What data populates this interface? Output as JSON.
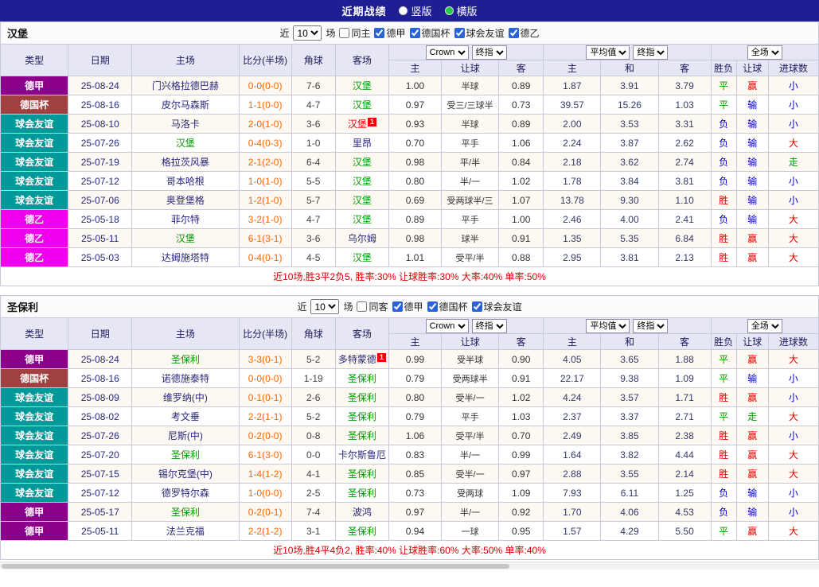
{
  "topbar": {
    "title": "近期战绩",
    "radio_vertical": "竖版",
    "radio_horizontal": "横版"
  },
  "table_header": {
    "cols": [
      "类型",
      "日期",
      "主场",
      "比分(半场)",
      "角球",
      "客场"
    ],
    "odds_dd1": "Crown",
    "odds_dd2": "终指",
    "avg_dd1": "平均值",
    "avg_dd2": "终指",
    "full_dd": "全场",
    "sub": [
      "主",
      "让球",
      "客",
      "主",
      "和",
      "客",
      "胜负",
      "让球",
      "进球数"
    ]
  },
  "colors": {
    "topbar_bg": "#1F1F93",
    "radio_selected": "#22CC44",
    "league": {
      "德甲": "#8B008B",
      "德国杯": "#A04040",
      "球会友谊": "#009999",
      "德乙": "#EE00EE"
    },
    "team_highlight": "#009900",
    "team_alert": "#EE0000",
    "score": "#FF6600",
    "summary": "#D40000",
    "result": {
      "g": "#009900",
      "r": "#E60000",
      "b": "#0000D0"
    }
  },
  "sections": [
    {
      "team": "汉堡",
      "filter": {
        "near": "近",
        "count": "10",
        "games": "场",
        "same": "同主",
        "same_checked": false,
        "leagues": [
          "德甲",
          "德国杯",
          "球会友谊",
          "德乙"
        ]
      },
      "rows": [
        {
          "league": "德甲",
          "date": "25-08-24",
          "home": "门兴格拉德巴赫",
          "score": "0-0(0-0)",
          "corner": "7-6",
          "away": "汉堡",
          "away_cls": "hl",
          "o1": "1.00",
          "handicap": "半球",
          "o2": "0.89",
          "a1": "1.87",
          "a2": "3.91",
          "a3": "3.79",
          "r1": "平",
          "r1c": "g",
          "r2": "赢",
          "r2c": "r",
          "r3": "小",
          "r3c": "b"
        },
        {
          "league": "德国杯",
          "date": "25-08-16",
          "home": "皮尔马森斯",
          "score": "1-1(0-0)",
          "corner": "4-7",
          "away": "汉堡",
          "away_cls": "hl",
          "o1": "0.97",
          "handicap": "受三/三球半",
          "o2": "0.73",
          "a1": "39.57",
          "a2": "15.26",
          "a3": "1.03",
          "r1": "平",
          "r1c": "g",
          "r2": "输",
          "r2c": "b",
          "r3": "小",
          "r3c": "b"
        },
        {
          "league": "球会友谊",
          "date": "25-08-10",
          "home": "马洛卡",
          "score": "2-0(1-0)",
          "corner": "3-6",
          "away": "汉堡",
          "away_cls": "rt",
          "away_sup": "1",
          "o1": "0.93",
          "handicap": "半球",
          "o2": "0.89",
          "a1": "2.00",
          "a2": "3.53",
          "a3": "3.31",
          "r1": "负",
          "r1c": "b",
          "r2": "输",
          "r2c": "b",
          "r3": "小",
          "r3c": "b"
        },
        {
          "league": "球会友谊",
          "date": "25-07-26",
          "home": "汉堡",
          "home_cls": "hl",
          "score": "0-4(0-3)",
          "corner": "1-0",
          "away": "里昂",
          "o1": "0.70",
          "handicap": "平手",
          "o2": "1.06",
          "a1": "2.24",
          "a2": "3.87",
          "a3": "2.62",
          "r1": "负",
          "r1c": "b",
          "r2": "输",
          "r2c": "b",
          "r3": "大",
          "r3c": "r"
        },
        {
          "league": "球会友谊",
          "date": "25-07-19",
          "home": "格拉茨风暴",
          "score": "2-1(2-0)",
          "corner": "6-4",
          "away": "汉堡",
          "away_cls": "hl",
          "o1": "0.98",
          "handicap": "平/半",
          "o2": "0.84",
          "a1": "2.18",
          "a2": "3.62",
          "a3": "2.74",
          "r1": "负",
          "r1c": "b",
          "r2": "输",
          "r2c": "b",
          "r3": "走",
          "r3c": "g"
        },
        {
          "league": "球会友谊",
          "date": "25-07-12",
          "home": "哥本哈根",
          "score": "1-0(1-0)",
          "corner": "5-5",
          "away": "汉堡",
          "away_cls": "hl",
          "o1": "0.80",
          "handicap": "半/一",
          "o2": "1.02",
          "a1": "1.78",
          "a2": "3.84",
          "a3": "3.81",
          "r1": "负",
          "r1c": "b",
          "r2": "输",
          "r2c": "b",
          "r3": "小",
          "r3c": "b"
        },
        {
          "league": "球会友谊",
          "date": "25-07-06",
          "home": "奥登堡格",
          "score": "1-2(1-0)",
          "corner": "5-7",
          "away": "汉堡",
          "away_cls": "hl",
          "o1": "0.69",
          "handicap": "受两球半/三",
          "o2": "1.07",
          "a1": "13.78",
          "a2": "9.30",
          "a3": "1.10",
          "r1": "胜",
          "r1c": "r",
          "r2": "输",
          "r2c": "b",
          "r3": "小",
          "r3c": "b"
        },
        {
          "league": "德乙",
          "date": "25-05-18",
          "home": "菲尔特",
          "score": "3-2(1-0)",
          "corner": "4-7",
          "away": "汉堡",
          "away_cls": "hl",
          "o1": "0.89",
          "handicap": "平手",
          "o2": "1.00",
          "a1": "2.46",
          "a2": "4.00",
          "a3": "2.41",
          "r1": "负",
          "r1c": "b",
          "r2": "输",
          "r2c": "b",
          "r3": "大",
          "r3c": "r"
        },
        {
          "league": "德乙",
          "date": "25-05-11",
          "home": "汉堡",
          "home_cls": "hl",
          "score": "6-1(3-1)",
          "corner": "3-6",
          "away": "乌尔姆",
          "o1": "0.98",
          "handicap": "球半",
          "o2": "0.91",
          "a1": "1.35",
          "a2": "5.35",
          "a3": "6.84",
          "r1": "胜",
          "r1c": "r",
          "r2": "赢",
          "r2c": "r",
          "r3": "大",
          "r3c": "r"
        },
        {
          "league": "德乙",
          "date": "25-05-03",
          "home": "达姆施塔特",
          "score": "0-4(0-1)",
          "corner": "4-5",
          "away": "汉堡",
          "away_cls": "hl",
          "o1": "1.01",
          "handicap": "受平/半",
          "o2": "0.88",
          "a1": "2.95",
          "a2": "3.81",
          "a3": "2.13",
          "r1": "胜",
          "r1c": "r",
          "r2": "赢",
          "r2c": "r",
          "r3": "大",
          "r3c": "r"
        }
      ],
      "summary": "近10场,胜3平2负5, 胜率:30% 让球胜率:30% 大率:40% 单率:50%"
    },
    {
      "team": "圣保利",
      "filter": {
        "near": "近",
        "count": "10",
        "games": "场",
        "same": "同客",
        "same_checked": false,
        "leagues": [
          "德甲",
          "德国杯",
          "球会友谊"
        ]
      },
      "rows": [
        {
          "league": "德甲",
          "date": "25-08-24",
          "home": "圣保利",
          "home_cls": "hl",
          "score": "3-3(0-1)",
          "corner": "5-2",
          "away": "多特蒙德",
          "away_sup": "1",
          "o1": "0.99",
          "handicap": "受半球",
          "o2": "0.90",
          "a1": "4.05",
          "a2": "3.65",
          "a3": "1.88",
          "r1": "平",
          "r1c": "g",
          "r2": "赢",
          "r2c": "r",
          "r3": "大",
          "r3c": "r"
        },
        {
          "league": "德国杯",
          "date": "25-08-16",
          "home": "诺德施泰特",
          "score": "0-0(0-0)",
          "corner": "1-19",
          "away": "圣保利",
          "away_cls": "hl",
          "o1": "0.79",
          "handicap": "受两球半",
          "o2": "0.91",
          "a1": "22.17",
          "a2": "9.38",
          "a3": "1.09",
          "r1": "平",
          "r1c": "g",
          "r2": "输",
          "r2c": "b",
          "r3": "小",
          "r3c": "b"
        },
        {
          "league": "球会友谊",
          "date": "25-08-09",
          "home": "维罗纳(中)",
          "score": "0-1(0-1)",
          "corner": "2-6",
          "away": "圣保利",
          "away_cls": "hl",
          "o1": "0.80",
          "handicap": "受半/一",
          "o2": "1.02",
          "a1": "4.24",
          "a2": "3.57",
          "a3": "1.71",
          "r1": "胜",
          "r1c": "r",
          "r2": "赢",
          "r2c": "r",
          "r3": "小",
          "r3c": "b"
        },
        {
          "league": "球会友谊",
          "date": "25-08-02",
          "home": "考文垂",
          "score": "2-2(1-1)",
          "corner": "5-2",
          "away": "圣保利",
          "away_cls": "hl",
          "o1": "0.79",
          "handicap": "平手",
          "o2": "1.03",
          "a1": "2.37",
          "a2": "3.37",
          "a3": "2.71",
          "r1": "平",
          "r1c": "g",
          "r2": "走",
          "r2c": "g",
          "r3": "大",
          "r3c": "r"
        },
        {
          "league": "球会友谊",
          "date": "25-07-26",
          "home": "尼斯(中)",
          "score": "0-2(0-0)",
          "corner": "0-8",
          "away": "圣保利",
          "away_cls": "hl",
          "o1": "1.06",
          "handicap": "受平/半",
          "o2": "0.70",
          "a1": "2.49",
          "a2": "3.85",
          "a3": "2.38",
          "r1": "胜",
          "r1c": "r",
          "r2": "赢",
          "r2c": "r",
          "r3": "小",
          "r3c": "b"
        },
        {
          "league": "球会友谊",
          "date": "25-07-20",
          "home": "圣保利",
          "home_cls": "hl",
          "score": "6-1(3-0)",
          "corner": "0-0",
          "away": "卡尔斯鲁厄",
          "o1": "0.83",
          "handicap": "半/一",
          "o2": "0.99",
          "a1": "1.64",
          "a2": "3.82",
          "a3": "4.44",
          "r1": "胜",
          "r1c": "r",
          "r2": "赢",
          "r2c": "r",
          "r3": "大",
          "r3c": "r"
        },
        {
          "league": "球会友谊",
          "date": "25-07-15",
          "home": "锡尔克堡(中)",
          "score": "1-4(1-2)",
          "corner": "4-1",
          "away": "圣保利",
          "away_cls": "hl",
          "o1": "0.85",
          "handicap": "受半/一",
          "o2": "0.97",
          "a1": "2.88",
          "a2": "3.55",
          "a3": "2.14",
          "r1": "胜",
          "r1c": "r",
          "r2": "赢",
          "r2c": "r",
          "r3": "大",
          "r3c": "r"
        },
        {
          "league": "球会友谊",
          "date": "25-07-12",
          "home": "德罗特尔森",
          "score": "1-0(0-0)",
          "corner": "2-5",
          "away": "圣保利",
          "away_cls": "hl",
          "o1": "0.73",
          "handicap": "受两球",
          "o2": "1.09",
          "a1": "7.93",
          "a2": "6.11",
          "a3": "1.25",
          "r1": "负",
          "r1c": "b",
          "r2": "输",
          "r2c": "b",
          "r3": "小",
          "r3c": "b"
        },
        {
          "league": "德甲",
          "date": "25-05-17",
          "home": "圣保利",
          "home_cls": "hl",
          "score": "0-2(0-1)",
          "corner": "7-4",
          "away": "波鸿",
          "o1": "0.97",
          "handicap": "半/一",
          "o2": "0.92",
          "a1": "1.70",
          "a2": "4.06",
          "a3": "4.53",
          "r1": "负",
          "r1c": "b",
          "r2": "输",
          "r2c": "b",
          "r3": "小",
          "r3c": "b"
        },
        {
          "league": "德甲",
          "date": "25-05-11",
          "home": "法兰克福",
          "score": "2-2(1-2)",
          "corner": "3-1",
          "away": "圣保利",
          "away_cls": "hl",
          "o1": "0.94",
          "handicap": "一球",
          "o2": "0.95",
          "a1": "1.57",
          "a2": "4.29",
          "a3": "5.50",
          "r1": "平",
          "r1c": "g",
          "r2": "赢",
          "r2c": "r",
          "r3": "大",
          "r3c": "r"
        }
      ],
      "summary": "近10场,胜4平4负2, 胜率:40% 让球胜率:60% 大率:50% 单率:40%"
    }
  ]
}
